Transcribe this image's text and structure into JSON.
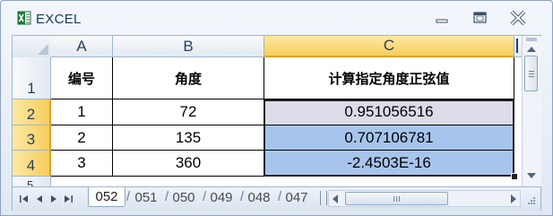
{
  "window": {
    "title": "EXCEL",
    "icons": {
      "app": "excel-icon",
      "minimize": "minimize-icon",
      "maximize": "maximize-icon",
      "close": "close-icon"
    }
  },
  "sheet": {
    "columns": [
      "A",
      "B",
      "C"
    ],
    "selected_column": "C",
    "rows": [
      {
        "row": "1",
        "cells": [
          "编号",
          "角度",
          "计算指定角度正弦值"
        ]
      },
      {
        "row": "2",
        "cells": [
          "1",
          "72",
          "0.951056516"
        ]
      },
      {
        "row": "3",
        "cells": [
          "2",
          "135",
          "0.707106781"
        ]
      },
      {
        "row": "4",
        "cells": [
          "3",
          "360",
          "-2.4503E-16"
        ]
      }
    ],
    "partial_row": "5",
    "selected_rows": [
      "2",
      "3",
      "4"
    ],
    "active_cell": "C2",
    "selection_range": "C2:C4",
    "colors": {
      "selection_fill": "#a7c4ec",
      "active_fill": "#dcdce8",
      "header_highlight": "#f7cd5e"
    }
  },
  "tabs": {
    "items": [
      "052",
      "051",
      "050",
      "049",
      "048",
      "047"
    ],
    "active": "052",
    "nav_icons": [
      "first-sheet-icon",
      "prev-sheet-icon",
      "next-sheet-icon",
      "last-sheet-icon"
    ]
  }
}
